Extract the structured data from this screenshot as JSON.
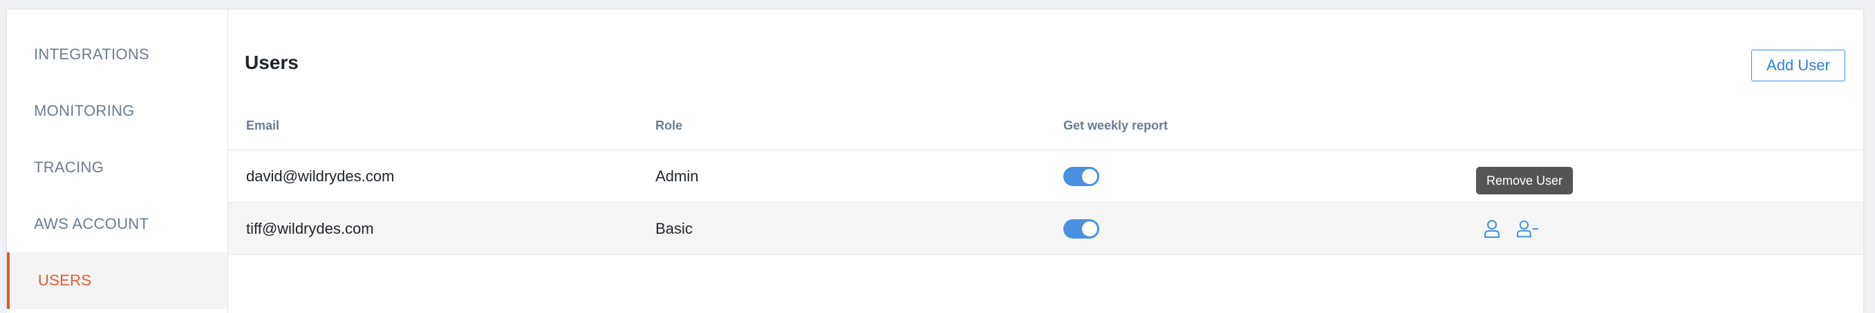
{
  "sidebar": {
    "items": [
      {
        "label": "INTEGRATIONS",
        "active": false
      },
      {
        "label": "MONITORING",
        "active": false
      },
      {
        "label": "TRACING",
        "active": false
      },
      {
        "label": "AWS ACCOUNT",
        "active": false
      },
      {
        "label": "USERS",
        "active": true
      }
    ]
  },
  "main": {
    "title": "Users",
    "add_user_label": "Add User",
    "table": {
      "headers": {
        "email": "Email",
        "role": "Role",
        "weekly_report": "Get weekly report"
      },
      "rows": [
        {
          "email": "david@wildrydes.com",
          "role": "Admin",
          "weekly_report": true
        },
        {
          "email": "tiff@wildrydes.com",
          "role": "Basic",
          "weekly_report": true
        }
      ]
    },
    "tooltip": "Remove User"
  },
  "colors": {
    "accent": "#e4572e",
    "primary": "#4a90e2",
    "muted_text": "#6b7c8f"
  },
  "icons": {
    "row_actions": [
      "user-icon",
      "remove-user-icon"
    ]
  }
}
